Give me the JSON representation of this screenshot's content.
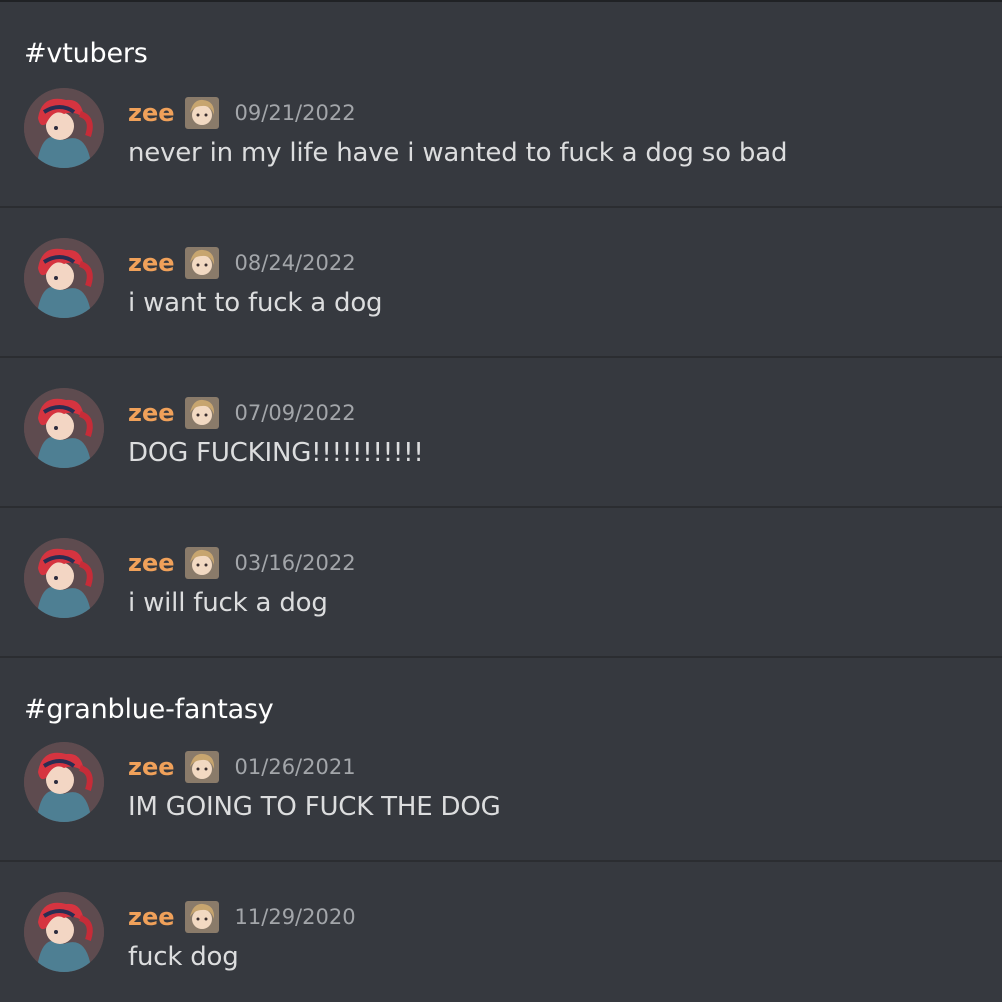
{
  "channels": [
    {
      "name": "#vtubers",
      "messages": [
        {
          "username": "zee",
          "avatar": "avatar-icon",
          "badge": "profile-badge-icon",
          "timestamp": "09/21/2022",
          "content": "never in my life have i wanted to fuck a dog so bad"
        },
        {
          "username": "zee",
          "avatar": "avatar-icon",
          "badge": "profile-badge-icon",
          "timestamp": "08/24/2022",
          "content": "i want to fuck a dog"
        },
        {
          "username": "zee",
          "avatar": "avatar-icon",
          "badge": "profile-badge-icon",
          "timestamp": "07/09/2022",
          "content": "DOG FUCKING!!!!!!!!!!!"
        },
        {
          "username": "zee",
          "avatar": "avatar-icon",
          "badge": "profile-badge-icon",
          "timestamp": "03/16/2022",
          "content": "i will fuck a dog"
        }
      ]
    },
    {
      "name": "#granblue-fantasy",
      "messages": [
        {
          "username": "zee",
          "avatar": "avatar-icon",
          "badge": "profile-badge-icon",
          "timestamp": "01/26/2021",
          "content": "IM GOING TO FUCK THE DOG"
        },
        {
          "username": "zee",
          "avatar": "avatar-icon",
          "badge": "profile-badge-icon",
          "timestamp": "11/29/2020",
          "content": "fuck dog"
        }
      ]
    }
  ],
  "colors": {
    "background": "#36393f",
    "username": "#f0a15a",
    "timestamp": "#a3a6aa",
    "message_text": "#dcddde",
    "divider": "#2b2d31"
  }
}
